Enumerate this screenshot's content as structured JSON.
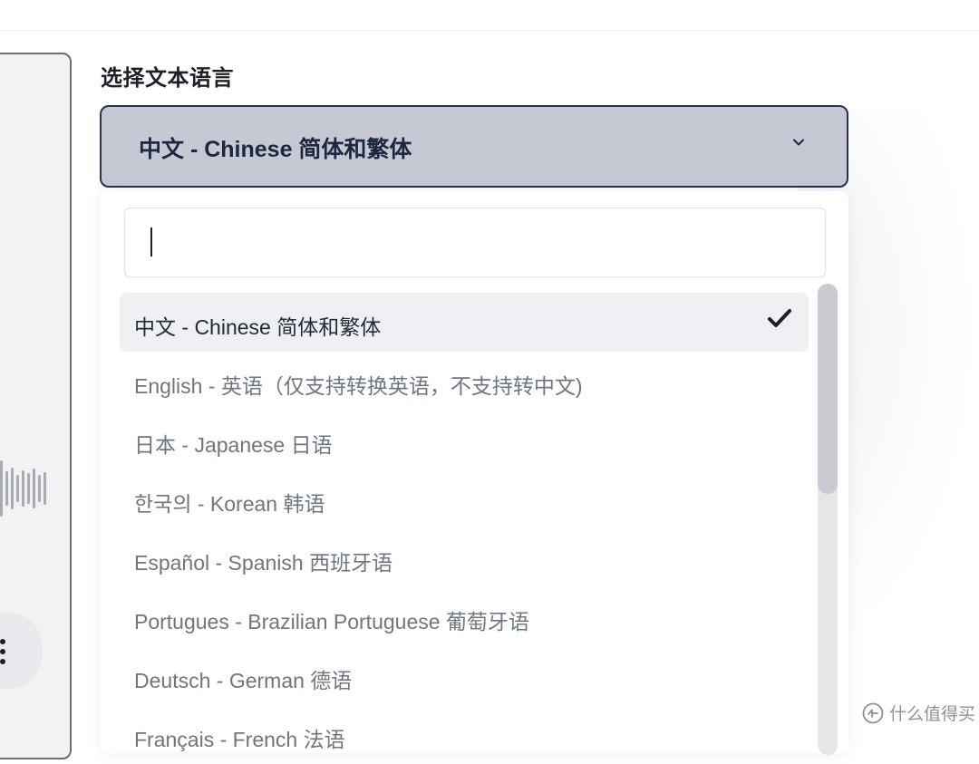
{
  "section": {
    "label": "选择文本语言"
  },
  "select": {
    "value": "中文 - Chinese 简体和繁体",
    "icon": "chevron-down-icon"
  },
  "search": {
    "value": "",
    "placeholder": ""
  },
  "options": [
    {
      "label": "中文 - Chinese 简体和繁体",
      "selected": true
    },
    {
      "label": "English - 英语（仅支持转换英语，不支持转中文)",
      "selected": false
    },
    {
      "label": "日本 - Japanese 日语",
      "selected": false
    },
    {
      "label": "한국의 - Korean 韩语",
      "selected": false
    },
    {
      "label": "Español - Spanish 西班牙语",
      "selected": false
    },
    {
      "label": "Portugues - Brazilian Portuguese 葡萄牙语",
      "selected": false
    },
    {
      "label": "Deutsch - German 德语",
      "selected": false
    },
    {
      "label": "Français - French 法语",
      "selected": false
    }
  ],
  "selected_check_icon": "check-icon",
  "watermark": {
    "text": "什么值得买",
    "icon": "smzdm-logo-icon"
  },
  "colors": {
    "select_bg": "#c6c9d3",
    "select_border": "#27344b",
    "option_text": "#6d7683",
    "selected_bg": "#eff0f3"
  }
}
